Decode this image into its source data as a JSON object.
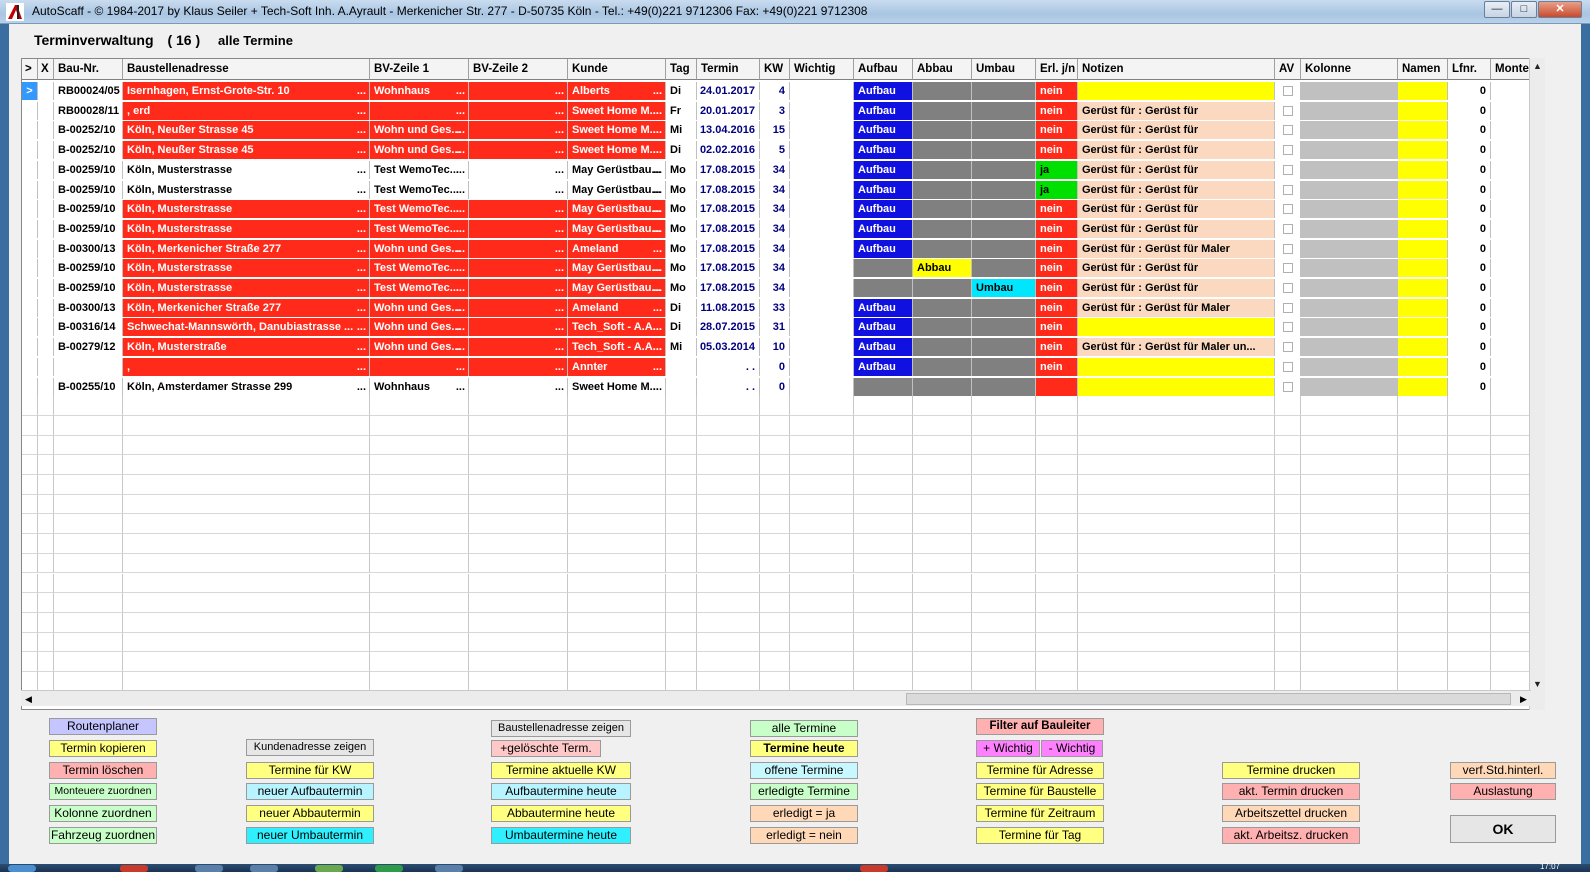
{
  "window": {
    "title": "AutoScaff - © 1984-2017 by Klaus Seiler + Tech-Soft Inh. A.Ayrault - Merkenicher Str. 277 - D-50735 Köln - Tel.: +49(0)221 9712306  Fax: +49(0)221 9712308",
    "minimize": "—",
    "maximize": "□",
    "close": "✕"
  },
  "header": {
    "title": "Terminverwaltung",
    "count": "( 16 )",
    "subtitle": "alle Termine"
  },
  "grid": {
    "columns": [
      ">",
      "X",
      "Bau-Nr.",
      "Baustellenadresse",
      "BV-Zeile 1",
      "BV-Zeile 2",
      "Kunde",
      "Tag",
      "Termin",
      "KW",
      "Wichtig",
      "Aufbau",
      "Abbau",
      "Umbau",
      "Erl. j/n",
      "Notizen",
      "AV",
      "Kolonne",
      "Namen",
      "Lfnr.",
      "Monteu"
    ],
    "rows": [
      {
        "sel": ">",
        "baunr": "RB00024/05",
        "adresse": "Isernhagen, Ernst-Grote-Str. 10",
        "bv1": "Wohnhaus",
        "bv2": "",
        "kunde": "Alberts",
        "tag": "Di",
        "termin": "24.01.2017",
        "kw": "4",
        "aufbau": "Aufbau",
        "abbau": "",
        "umbau": "",
        "erl": "nein",
        "notizen": "",
        "lfnr": "0",
        "red": true
      },
      {
        "sel": "",
        "baunr": "RB00028/11",
        "adresse": ", erd",
        "bv1": "",
        "bv2": "",
        "kunde": "Sweet Home M...",
        "tag": "Fr",
        "termin": "20.01.2017",
        "kw": "3",
        "aufbau": "Aufbau",
        "abbau": "",
        "umbau": "",
        "erl": "nein",
        "notizen": "Gerüst für :  Gerüst für",
        "lfnr": "0",
        "red": true
      },
      {
        "sel": "",
        "baunr": "B-00252/10",
        "adresse": "Köln, Neußer Strasse 45",
        "bv1": "Wohn und Ges...",
        "bv2": "",
        "kunde": "Sweet Home M...",
        "tag": "Mi",
        "termin": "13.04.2016",
        "kw": "15",
        "aufbau": "Aufbau",
        "abbau": "",
        "umbau": "",
        "erl": "nein",
        "notizen": "Gerüst für :  Gerüst für",
        "lfnr": "0",
        "red": true
      },
      {
        "sel": "",
        "baunr": "B-00252/10",
        "adresse": "Köln, Neußer Strasse 45",
        "bv1": "Wohn und Ges...",
        "bv2": "",
        "kunde": "Sweet Home M...",
        "tag": "Di",
        "termin": "02.02.2016",
        "kw": "5",
        "aufbau": "Aufbau",
        "abbau": "",
        "umbau": "",
        "erl": "nein",
        "notizen": "Gerüst für :  Gerüst für",
        "lfnr": "0",
        "red": true
      },
      {
        "sel": "",
        "baunr": "B-00259/10",
        "adresse": "Köln, Musterstrasse",
        "bv1": "Test WemoTec...",
        "bv2": "",
        "kunde": "May Gerüstbau...",
        "tag": "Mo",
        "termin": "17.08.2015",
        "kw": "34",
        "aufbau": "Aufbau",
        "abbau": "",
        "umbau": "",
        "erl": "ja",
        "notizen": "Gerüst für :  Gerüst für",
        "lfnr": "0",
        "red": false
      },
      {
        "sel": "",
        "baunr": "B-00259/10",
        "adresse": "Köln, Musterstrasse",
        "bv1": "Test WemoTec...",
        "bv2": "",
        "kunde": "May Gerüstbau...",
        "tag": "Mo",
        "termin": "17.08.2015",
        "kw": "34",
        "aufbau": "Aufbau",
        "abbau": "",
        "umbau": "",
        "erl": "ja",
        "notizen": "Gerüst für :  Gerüst für",
        "lfnr": "0",
        "red": false
      },
      {
        "sel": "",
        "baunr": "B-00259/10",
        "adresse": "Köln, Musterstrasse",
        "bv1": "Test WemoTec...",
        "bv2": "",
        "kunde": "May Gerüstbau...",
        "tag": "Mo",
        "termin": "17.08.2015",
        "kw": "34",
        "aufbau": "Aufbau",
        "abbau": "",
        "umbau": "",
        "erl": "nein",
        "notizen": "Gerüst für :  Gerüst für",
        "lfnr": "0",
        "red": true
      },
      {
        "sel": "",
        "baunr": "B-00259/10",
        "adresse": "Köln, Musterstrasse",
        "bv1": "Test WemoTec...",
        "bv2": "",
        "kunde": "May Gerüstbau...",
        "tag": "Mo",
        "termin": "17.08.2015",
        "kw": "34",
        "aufbau": "Aufbau",
        "abbau": "",
        "umbau": "",
        "erl": "nein",
        "notizen": "Gerüst für :  Gerüst für",
        "lfnr": "0",
        "red": true
      },
      {
        "sel": "",
        "baunr": "B-00300/13",
        "adresse": "Köln, Merkenicher Straße 277",
        "bv1": "Wohn und Ges...",
        "bv2": "",
        "kunde": "Ameland",
        "tag": "Mo",
        "termin": "17.08.2015",
        "kw": "34",
        "aufbau": "Aufbau",
        "abbau": "",
        "umbau": "",
        "erl": "nein",
        "notizen": "Gerüst für :  Gerüst für Maler",
        "lfnr": "0",
        "red": true
      },
      {
        "sel": "",
        "baunr": "B-00259/10",
        "adresse": "Köln, Musterstrasse",
        "bv1": "Test WemoTec...",
        "bv2": "",
        "kunde": "May Gerüstbau...",
        "tag": "Mo",
        "termin": "17.08.2015",
        "kw": "34",
        "aufbau": "",
        "abbau": "Abbau",
        "umbau": "",
        "erl": "nein",
        "notizen": "Gerüst für :  Gerüst für",
        "lfnr": "0",
        "red": true
      },
      {
        "sel": "",
        "baunr": "B-00259/10",
        "adresse": "Köln, Musterstrasse",
        "bv1": "Test WemoTec...",
        "bv2": "",
        "kunde": "May Gerüstbau...",
        "tag": "Mo",
        "termin": "17.08.2015",
        "kw": "34",
        "aufbau": "",
        "abbau": "",
        "umbau": "Umbau",
        "erl": "nein",
        "notizen": "Gerüst für :  Gerüst für",
        "lfnr": "0",
        "red": true
      },
      {
        "sel": "",
        "baunr": "B-00300/13",
        "adresse": "Köln, Merkenicher Straße 277",
        "bv1": "Wohn und Ges...",
        "bv2": "",
        "kunde": "Ameland",
        "tag": "Di",
        "termin": "11.08.2015",
        "kw": "33",
        "aufbau": "Aufbau",
        "abbau": "",
        "umbau": "",
        "erl": "nein",
        "notizen": "Gerüst für :  Gerüst für Maler",
        "lfnr": "0",
        "red": true
      },
      {
        "sel": "",
        "baunr": "B-00316/14",
        "adresse": "Schwechat-Mannswörth, Danubiastrasse ...",
        "bv1": "Wohn und Ges...",
        "bv2": "",
        "kunde": "Tech_Soft - A.A...",
        "tag": "Di",
        "termin": "28.07.2015",
        "kw": "31",
        "aufbau": "Aufbau",
        "abbau": "",
        "umbau": "",
        "erl": "nein",
        "notizen": "",
        "lfnr": "0",
        "red": true
      },
      {
        "sel": "",
        "baunr": "B-00279/12",
        "adresse": "Köln, Musterstraße",
        "bv1": "Wohn und Ges...",
        "bv2": "",
        "kunde": "Tech_Soft - A.A...",
        "tag": "Mi",
        "termin": "05.03.2014",
        "kw": "10",
        "aufbau": "Aufbau",
        "abbau": "",
        "umbau": "",
        "erl": "nein",
        "notizen": "Gerüst für :  Gerüst für Maler un...",
        "lfnr": "0",
        "red": true
      },
      {
        "sel": "",
        "baunr": "",
        "adresse": ",",
        "bv1": "",
        "bv2": "",
        "kunde": "Annter",
        "tag": "",
        "termin": ". .",
        "kw": "0",
        "aufbau": "Aufbau",
        "abbau": "",
        "umbau": "",
        "erl": "nein",
        "notizen": "",
        "lfnr": "0",
        "red": true
      },
      {
        "sel": "",
        "baunr": "B-00255/10",
        "adresse": "Köln, Amsterdamer Strasse 299",
        "bv1": "Wohnhaus",
        "bv2": "",
        "kunde": "Sweet Home M...",
        "tag": "",
        "termin": ". .",
        "kw": "0",
        "aufbau": "",
        "abbau": "",
        "umbau": "",
        "erl": "",
        "notizen": "",
        "lfnr": "0",
        "red": false
      }
    ],
    "dots": "..."
  },
  "buttons": {
    "routenplaner": "Routenplaner",
    "termin_kopieren": "Termin kopieren",
    "termin_loeschen": "Termin löschen",
    "monteuere_zuordnen": "Monteuere zuordnen",
    "kolonne_zuordnen": "Kolonne zuordnen",
    "fahrzeug_zuordnen": "Fahrzeug zuordnen",
    "kundenadresse_zeigen": "Kundenadresse zeigen",
    "termine_fuer_kw": "Termine für KW",
    "neuer_aufbautermin": "neuer Aufbautermin",
    "neuer_abbautermin": "neuer Abbautermin",
    "neuer_umbautermin": "neuer Umbautermin",
    "baustellenadresse_zeigen": "Baustellenadresse zeigen",
    "geloeschte_term": "+gelöschte Term.",
    "termine_aktuelle_kw": "Termine aktuelle KW",
    "aufbautermine_heute": "Aufbautermine heute",
    "abbautermine_heute": "Abbautermine heute",
    "umbautermine_heute": "Umbautermine heute",
    "alle_termine": "alle Termine",
    "termine_heute": "Termine heute",
    "offene_termine": "offene Termine",
    "erledigte_termine": "erledigte Termine",
    "erledigt_ja": "erledigt = ja",
    "erledigt_nein": "erledigt = nein",
    "filter_bauleiter": "Filter auf Bauleiter",
    "plus_wichtig": "+ Wichtig",
    "minus_wichtig": "- Wichtig",
    "termine_adresse": "Termine für Adresse",
    "termine_baustelle": "Termine für Baustelle",
    "termine_zeitraum": "Termine für Zeitraum",
    "termine_tag": "Termine für Tag",
    "termine_drucken": "Termine drucken",
    "akt_termin_drucken": "akt. Termin drucken",
    "arbeitszettel_drucken": "Arbeitszettel drucken",
    "akt_arbeitsz_drucken": "akt. Arbeitsz. drucken",
    "verf_std_hinterl": "verf.Std.hinterl.",
    "auslastung": "Auslastung",
    "ok": "OK"
  },
  "taskbar": {
    "clock": "17:07"
  }
}
